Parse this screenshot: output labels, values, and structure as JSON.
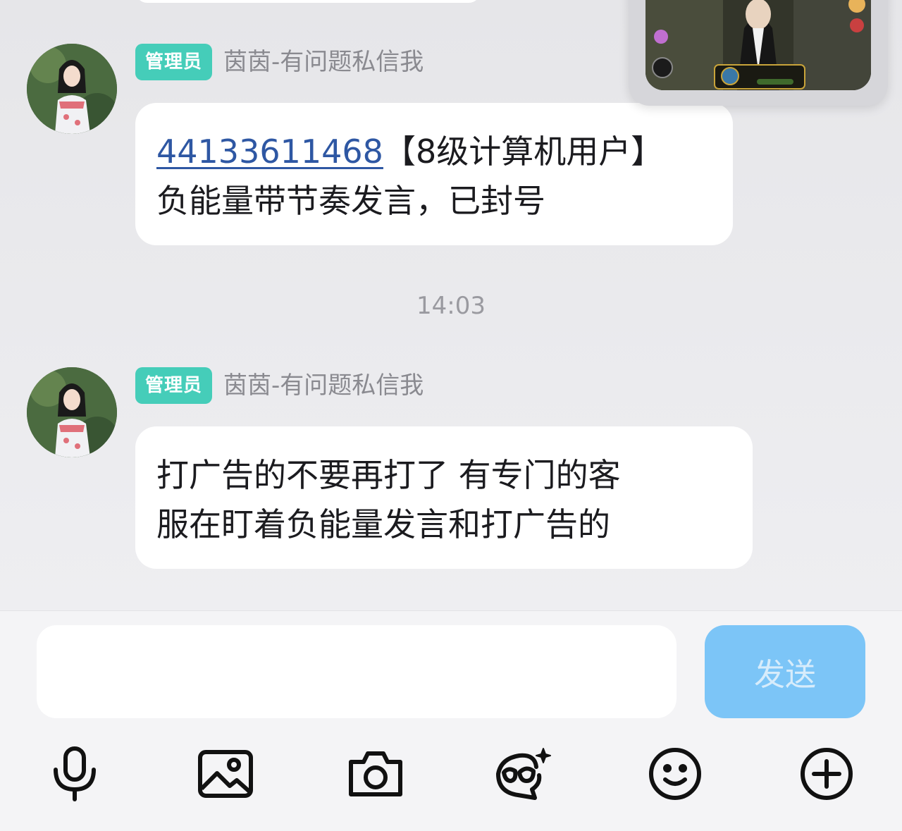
{
  "messages": [
    {
      "badge": "管理员",
      "sender": "茵茵-有问题私信我",
      "uid": "44133611468",
      "text_after_uid": "【8级计算机用户】",
      "text_line2": "负能量带节奏发言，已封号"
    },
    {
      "badge": "管理员",
      "sender": "茵茵-有问题私信我",
      "text_line1": "打广告的不要再打了 有专门的客",
      "text_line2": "服在盯着负能量发言和打广告的"
    }
  ],
  "timestamp": "14:03",
  "composer": {
    "placeholder": "",
    "send_label": "发送"
  },
  "toolbar": {
    "icons": [
      "microphone-icon",
      "image-icon",
      "camera-icon",
      "sticker-icon",
      "emoji-icon",
      "plus-icon"
    ]
  },
  "colors": {
    "admin_badge": "#45cdb9",
    "link": "#2e57a3",
    "send_button": "#7cc5f7"
  }
}
